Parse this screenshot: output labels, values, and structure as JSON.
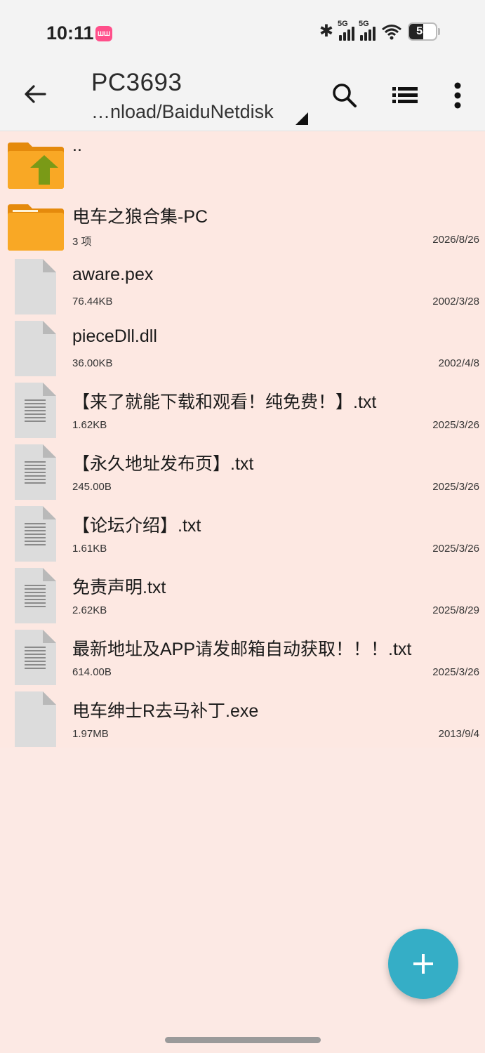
{
  "status_bar": {
    "time": "10:11",
    "app_badge": "ШШ",
    "signal1_tag": "5G",
    "signal2_tag": "5G",
    "battery_level": 53,
    "battery_text": "53"
  },
  "toolbar": {
    "title": "PC3693",
    "path": "…nload/BaiduNetdisk",
    "icons": [
      "back-arrow-icon",
      "search-icon",
      "list-view-icon",
      "more-vert-icon"
    ]
  },
  "files": [
    {
      "name": "..",
      "meta": "",
      "date": "",
      "type": "parent-folder"
    },
    {
      "name": "电车之狼合集-PC",
      "meta": "3 项",
      "date": "2026/8/26",
      "type": "folder"
    },
    {
      "name": "aware.pex",
      "meta": "76.44KB",
      "date": "2002/3/28",
      "type": "file"
    },
    {
      "name": "pieceDll.dll",
      "meta": "36.00KB",
      "date": "2002/4/8",
      "type": "file"
    },
    {
      "name": "【来了就能下载和观看！纯免费！】.txt",
      "meta": "1.62KB",
      "date": "2025/3/26",
      "type": "text"
    },
    {
      "name": "【永久地址发布页】.txt",
      "meta": "245.00B",
      "date": "2025/3/26",
      "type": "text"
    },
    {
      "name": "【论坛介绍】.txt",
      "meta": "1.61KB",
      "date": "2025/3/26",
      "type": "text"
    },
    {
      "name": "免责声明.txt",
      "meta": "2.62KB",
      "date": "2025/8/29",
      "type": "text"
    },
    {
      "name": "最新地址及APP请发邮箱自动获取！！！.txt",
      "meta": "614.00B",
      "date": "2025/3/26",
      "type": "text"
    },
    {
      "name": "电车绅士R去马补丁.exe",
      "meta": "1.97MB",
      "date": "2013/9/4",
      "type": "file"
    }
  ],
  "fab": {
    "icon": "plus-icon"
  },
  "colors": {
    "background": "#fce9e4",
    "bar": "#f3f3f3",
    "folder": "#f9a825",
    "fab": "#35aec6",
    "up_arrow": "#7a9a17"
  }
}
